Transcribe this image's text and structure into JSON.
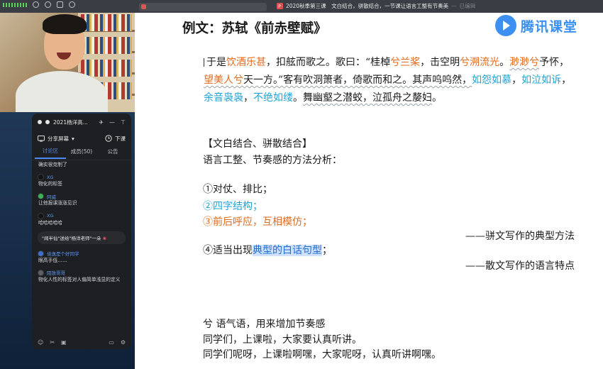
{
  "window": {
    "title": "2020秋季第三课　文白结合，骈散结合，一节课让语言工整有节奏美",
    "status": "已编辑"
  },
  "chat": {
    "room_title": "2021杨洋高...",
    "share_label": "分享屏幕",
    "leave_label": "下课",
    "tabs": [
      {
        "label": "讨论区"
      },
      {
        "label": "成员(50)"
      },
      {
        "label": "公告"
      }
    ],
    "messages": [
      {
        "user": "",
        "text": "确实很克制了"
      },
      {
        "user": "XG",
        "text": "物化的标签"
      },
      {
        "user": "阿威",
        "text": "让他报课涨涨见识"
      },
      {
        "user": "XG",
        "text": "哈哈哈哈哈"
      },
      {
        "user": "佳逸是个好同学",
        "text": "眼高手低……"
      },
      {
        "user": "陌放哥哥",
        "text": "物化人性的标签对人偏简单浅显的定义"
      }
    ],
    "gift_text": "\"闻半仙\"送给\"杨洋老师\"一朵",
    "gift_icon": "flower-icon"
  },
  "slide": {
    "title": "例文：苏轼《前赤壁赋》",
    "logo_text": "腾讯课堂",
    "poem": {
      "s1": "于是",
      "s2": "饮酒乐甚",
      "s3": "，扣舷而歌之。歌曰：“桂棹",
      "s4": "兮兰桨",
      "s5": "，击空明",
      "s6": "兮溯流光",
      "s7": "。",
      "s8": "渺渺兮",
      "s9": "予怀，",
      "s10": "望美人兮",
      "s11": "天一方。”客有吹洞箫者，倚歌而和之。其声呜呜然，",
      "s12": "如怨如慕",
      "s13": "，",
      "s14": "如泣如诉",
      "s15": "，",
      "s16": "余音袅袅",
      "s17": "，",
      "s18": "不绝如缕",
      "s19": "。",
      "s20": "舞幽壑之潜蛟，泣孤舟之嫠妇",
      "s21": "。"
    },
    "section_heading": "【文白结合、骈散结合】",
    "section_sub": "语言工整、节奏感的方法分析：",
    "points": {
      "p1": "①对仗、排比；",
      "p2": "②四字结构；",
      "p3": "③前后呼应，互相模仿；",
      "p4a": "④适当出现",
      "p4b": "典型的白话句型",
      "p4c": "；"
    },
    "note1": "——骈文写作的典型方法",
    "note2": "——散文写作的语言特点",
    "tail1": "兮  语气语，用来增加节奏感",
    "tail2": "同学们，上课啦，大家要认真听讲。",
    "tail3": "同学们呢呀，上课啦啊嘿，大家呢呀，认真听讲啊嘿。"
  },
  "colors": {
    "accent_orange": "#e26a1c",
    "accent_cyan": "#1ea4d4",
    "brand_blue": "#3b90f2",
    "chat_tab_active": "#4e8cf5"
  }
}
